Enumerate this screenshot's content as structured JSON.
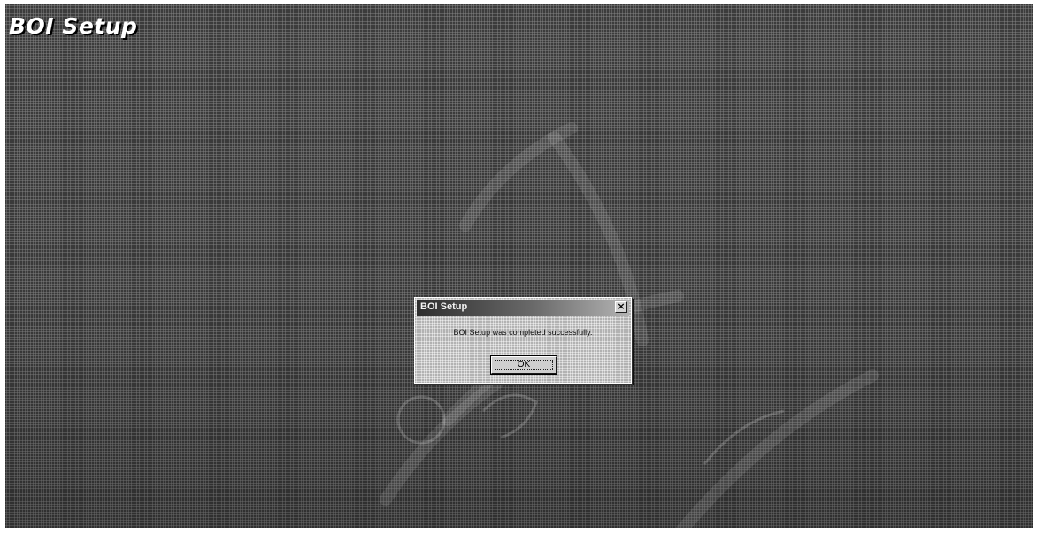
{
  "app": {
    "title": "BOI Setup"
  },
  "dialog": {
    "title": "BOI Setup",
    "close_symbol": "×",
    "message": "BOI Setup was completed successfully.",
    "ok_label": "OK"
  },
  "icons": {
    "close": "close-icon"
  },
  "colors": {
    "desktop": "#4b4b4b",
    "dialog_face": "#c8c8c8",
    "titlebar_start": "#2e2e2e",
    "titlebar_end": "#b4b4b4",
    "title_text": "#ffffff"
  }
}
